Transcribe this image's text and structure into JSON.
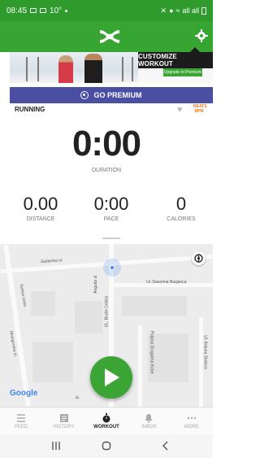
{
  "status_bar": {
    "time": "08:45",
    "temp": "10°",
    "signal_text": "all all"
  },
  "tooltip": {
    "text": "CUSTOMIZE WORKOUT"
  },
  "ad": {
    "cta": "Upgrade to Premium"
  },
  "premium": {
    "label": "GO PREMIUM"
  },
  "workout": {
    "activity": "RUNNING",
    "bpm_top": "BEATS",
    "bpm_bottom": "BPM",
    "duration_value": "0:00",
    "duration_label": "DURATION",
    "stats": [
      {
        "value": "0.00",
        "label": "DISTANCE"
      },
      {
        "value": "0:00",
        "label": "PACE"
      },
      {
        "value": "0",
        "label": "CALORIES"
      }
    ]
  },
  "map": {
    "streets": [
      "Zadarska ul.",
      "Selska cesta",
      "Mosigorska ul.",
      "UL. Brače Cvitića",
      "Anguša ul.",
      "Ul. Davorina Bazjanca",
      "Poljana Dragutina Kobe",
      "Ul. Antuna Stoteca",
      "ul."
    ],
    "provider": "Google"
  },
  "nav": {
    "items": [
      {
        "label": "FEED",
        "icon": "feed-icon",
        "active": false
      },
      {
        "label": "HISTORY",
        "icon": "history-icon",
        "active": false
      },
      {
        "label": "WORKOUT",
        "icon": "workout-icon",
        "active": true
      },
      {
        "label": "INBOX",
        "icon": "inbox-icon",
        "active": false
      },
      {
        "label": "MORE",
        "icon": "more-icon",
        "active": false
      }
    ]
  },
  "colors": {
    "brand_green": "#36a532",
    "premium_blue": "#4a4fa3",
    "accent_orange": "#f47a20"
  }
}
